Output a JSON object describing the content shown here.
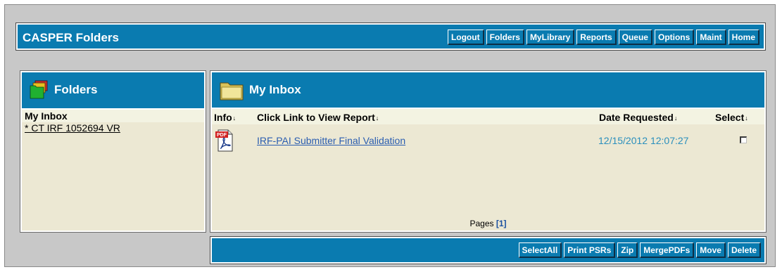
{
  "header": {
    "title": "CASPER Folders",
    "nav": [
      "Logout",
      "Folders",
      "MyLibrary",
      "Reports",
      "Queue",
      "Options",
      "Maint",
      "Home"
    ]
  },
  "folders_panel": {
    "title": "Folders",
    "items": [
      {
        "label": "My Inbox",
        "selected": true
      },
      {
        "label": "* CT IRF 1052694 VR",
        "selected": false
      }
    ]
  },
  "inbox": {
    "title": "My Inbox",
    "columns": {
      "info": "Info",
      "report": "Click Link to View Report",
      "date": "Date Requested",
      "select": "Select"
    },
    "rows": [
      {
        "icon": "pdf-icon",
        "report": "IRF-PAI Submitter Final Validation",
        "date": "12/15/2012 12:07:27",
        "selected": false
      }
    ],
    "pages_label": "Pages",
    "current_page": "[1]"
  },
  "footer": {
    "actions": [
      "SelectAll",
      "Print PSRs",
      "Zip",
      "MergePDFs",
      "Move",
      "Delete"
    ]
  },
  "colors": {
    "bar": "#0a7bb0",
    "panel": "#ece8d3",
    "selected_row": "#f3f3e2",
    "link": "#2a5db0",
    "date": "#2a8fbd"
  }
}
